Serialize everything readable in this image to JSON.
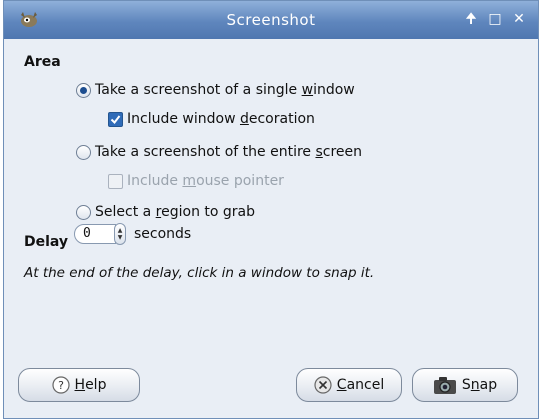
{
  "window": {
    "title": "Screenshot"
  },
  "icons": {
    "app": "gimp-icon",
    "up": "up-arrow-icon",
    "maximize": "maximize-icon",
    "close": "close-icon"
  },
  "area": {
    "heading": "Area",
    "single_window": {
      "pre": "Take a screenshot of a single ",
      "mn": "w",
      "post": "indow",
      "checked": true
    },
    "include_decoration": {
      "pre": "Include window ",
      "mn": "d",
      "post": "ecoration",
      "checked": true
    },
    "entire_screen": {
      "pre": "Take a screenshot of the entire ",
      "mn": "s",
      "post": "creen",
      "checked": false
    },
    "mouse_pointer": {
      "pre": "Include ",
      "mn": "m",
      "post": "ouse pointer",
      "checked": false,
      "disabled": true
    },
    "region": {
      "pre": "Select a ",
      "mn": "r",
      "post": "egion to grab",
      "checked": false
    }
  },
  "delay": {
    "heading": "Delay",
    "value": "0",
    "unit": "seconds"
  },
  "note": "At the end of the delay, click in a window to snap it.",
  "buttons": {
    "help": {
      "mn": "H",
      "post": "elp"
    },
    "cancel": {
      "mn": "C",
      "post": "ancel"
    },
    "snap": {
      "pre": "S",
      "mn": "n",
      "post": "ap"
    }
  }
}
